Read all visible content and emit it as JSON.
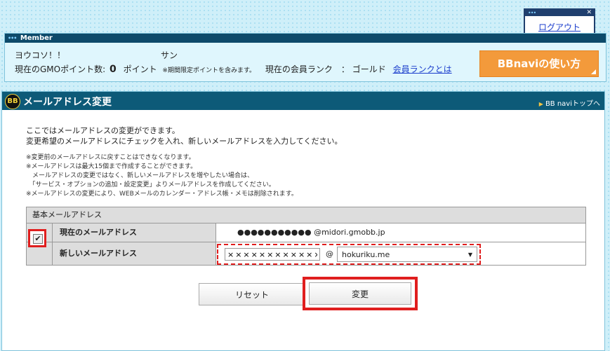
{
  "logout": {
    "label": "ログアウト"
  },
  "member": {
    "header": "Member",
    "greeting": "ヨウコソ！！",
    "honorific": "サン",
    "points_label": "現在のGMOポイント数:",
    "points_value": "0",
    "points_unit": "ポイント",
    "points_note": "※期間限定ポイントを含みます。",
    "rank_label": "現在の会員ランク　：",
    "rank_value": "ゴールド",
    "rank_link": "会員ランクとは",
    "howto_button": "BBnaviの使い方"
  },
  "page": {
    "icon_text": "BB",
    "title": "メールアドレス変更",
    "top_link": "BB naviトップへ"
  },
  "intro": [
    "ここではメールアドレスの変更ができます。",
    "変更希望のメールアドレスにチェックを入れ、新しいメールアドレスを入力してください。"
  ],
  "notes": [
    "※変更前のメールアドレスに戻すことはできなくなります。",
    "※メールアドレスは最大15個まで作成することができます。",
    "　メールアドレスの変更ではなく、新しいメールアドレスを増やしたい場合は、",
    "　「サービス・オプションの追加・設定変更」よりメールアドレスを作成してください。",
    "※メールアドレスの変更により、WEBメールのカレンダー・アドレス帳・メモは削除されます。"
  ],
  "table": {
    "header": "基本メールアドレス",
    "current_label": "現在のメールアドレス",
    "current_value": "●●●●●●●●●●● @midori.gmobb.jp",
    "new_label": "新しいメールアドレス",
    "checkbox_mark": "✔",
    "new_input_value": "××××××××××××",
    "at_sign": "@",
    "domain_selected": "hokuriku.me",
    "select_arrow": "▼"
  },
  "buttons": {
    "reset": "リセット",
    "change": "変更"
  }
}
